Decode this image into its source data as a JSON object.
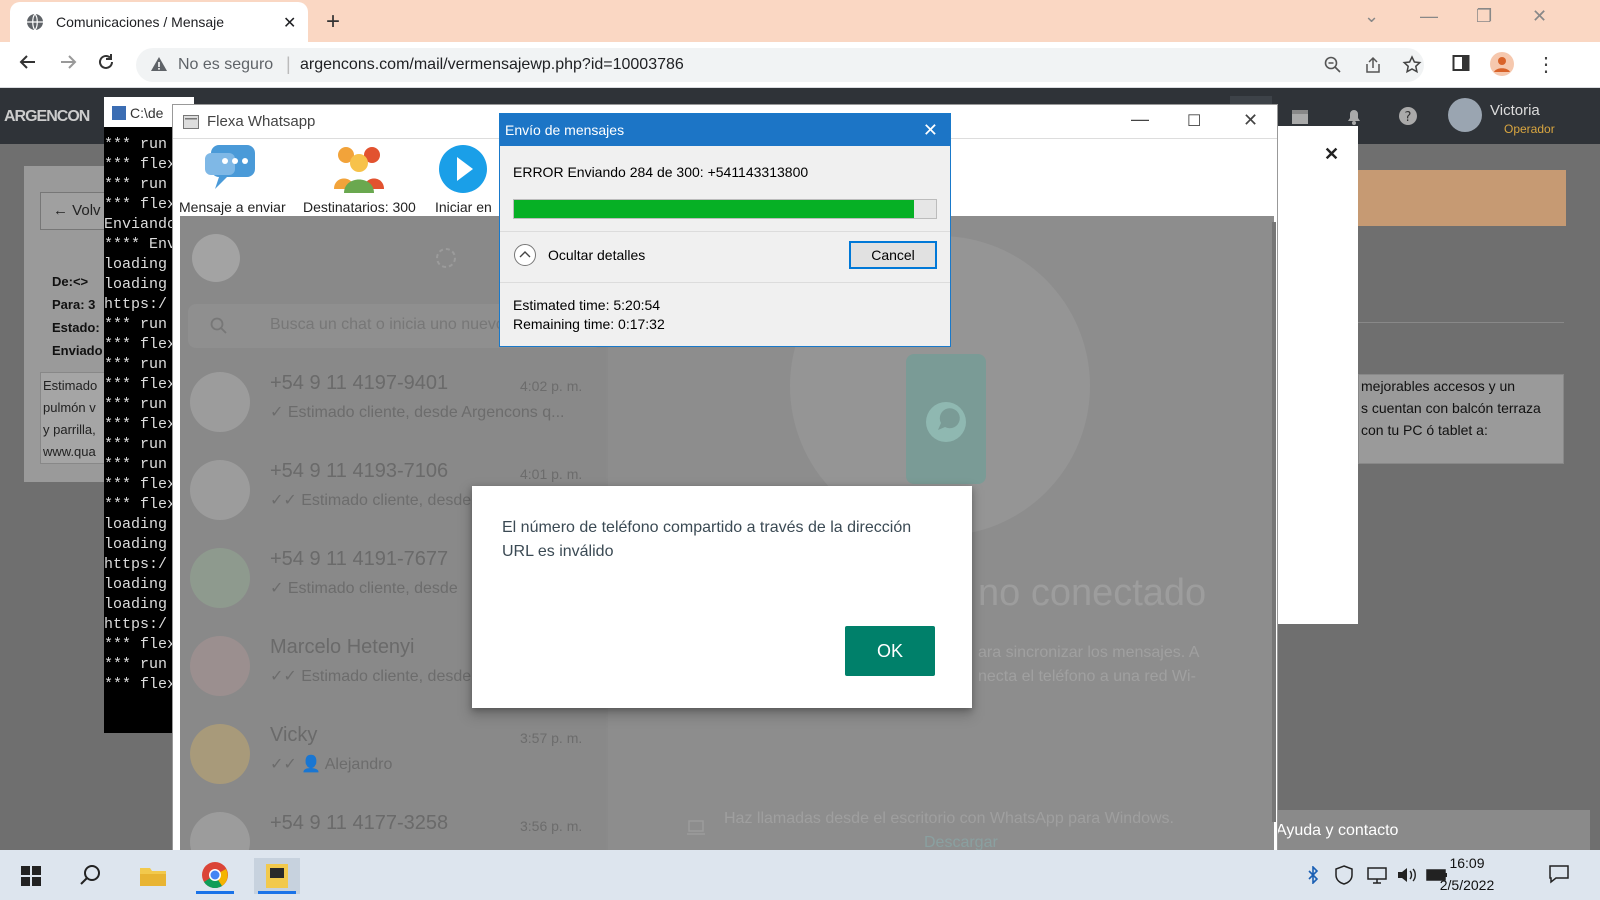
{
  "browser": {
    "tab_title": "Comunicaciones / Mensaje",
    "security_label": "No es seguro",
    "url": "argencons.com/mail/vermensajewp.php?id=10003786"
  },
  "page": {
    "back_label": "Volv",
    "fields": [
      "De:<>",
      "Para: 3",
      "Estado:",
      "Enviado"
    ],
    "message_snippet": [
      "Estimado",
      "pulmón v",
      "y parrilla,",
      "www.qua"
    ],
    "right_text": [
      "mejorables accesos y un",
      "s cuentan con balcón terraza",
      "con tu PC ó tablet a:"
    ],
    "footer_help": "Ayuda y contacto",
    "user_name": "Victoria",
    "user_role": "Operador",
    "logo": "ARGENCON"
  },
  "console": {
    "title": "C:\\de",
    "lines": [
      "*** run",
      "*** flex",
      "*** run",
      "*** flex",
      "Enviando",
      "**** Env",
      "loading",
      "loading",
      "https:/",
      "*** run",
      "*** flex",
      "*** run",
      "*** flex",
      "*** run",
      "*** flex",
      "*** run",
      "*** run",
      "*** flex",
      "*** flex",
      "loading",
      "loading",
      "https:/",
      "loading",
      "loading",
      "https:/",
      "*** flex",
      "*** run",
      "*** flex"
    ]
  },
  "flexa": {
    "window_title": "Flexa Whatsapp",
    "toolbar": {
      "message": "Mensaje a enviar",
      "recipients": "Destinatarios: 300",
      "start": "Iniciar en"
    },
    "search_placeholder": "Busca un chat o inicia uno nuevo",
    "chats": [
      {
        "name": "+54 9 11 4197-9401",
        "time": "4:02 p. m.",
        "preview": "✓ Estimado cliente, desde Argencons q..."
      },
      {
        "name": "+54 9 11 4193-7106",
        "time": "4:01 p. m.",
        "preview": "✓✓ Estimado cliente, desde"
      },
      {
        "name": "+54 9 11 4191-7677",
        "time": "",
        "preview": "✓ Estimado cliente, desde"
      },
      {
        "name": "Marcelo Hetenyi",
        "time": "",
        "preview": "✓✓ Estimado cliente, desde"
      },
      {
        "name": "Vicky",
        "time": "3:57 p. m.",
        "preview": "✓✓ 👤 Alejandro"
      },
      {
        "name": "+54 9 11 4177-3258",
        "time": "3:56 p. m.",
        "preview": ""
      }
    ],
    "right_panel": {
      "heading": "no conectado",
      "line1": "ara sincronizar los mensajes. A",
      "line2": "necta el teléfono a una red Wi-",
      "calls": "Haz llamadas desde el escritorio con WhatsApp para Windows.",
      "download": "Descargar"
    }
  },
  "envio_dialog": {
    "title": "Envío de mensajes",
    "error_text": "ERROR Enviando 284 de 300: +541143313800",
    "progress": 0.947,
    "details_label": "Ocultar detalles",
    "cancel_label": "Cancel",
    "estimated": "Estimated time: 5:20:54",
    "remaining": "Remaining time: 0:17:32"
  },
  "wa_alert": {
    "message": "El número de teléfono compartido a través de la dirección URL es inválido",
    "ok_label": "OK"
  },
  "taskbar": {
    "time": "16:09",
    "date": "2/5/2022"
  }
}
